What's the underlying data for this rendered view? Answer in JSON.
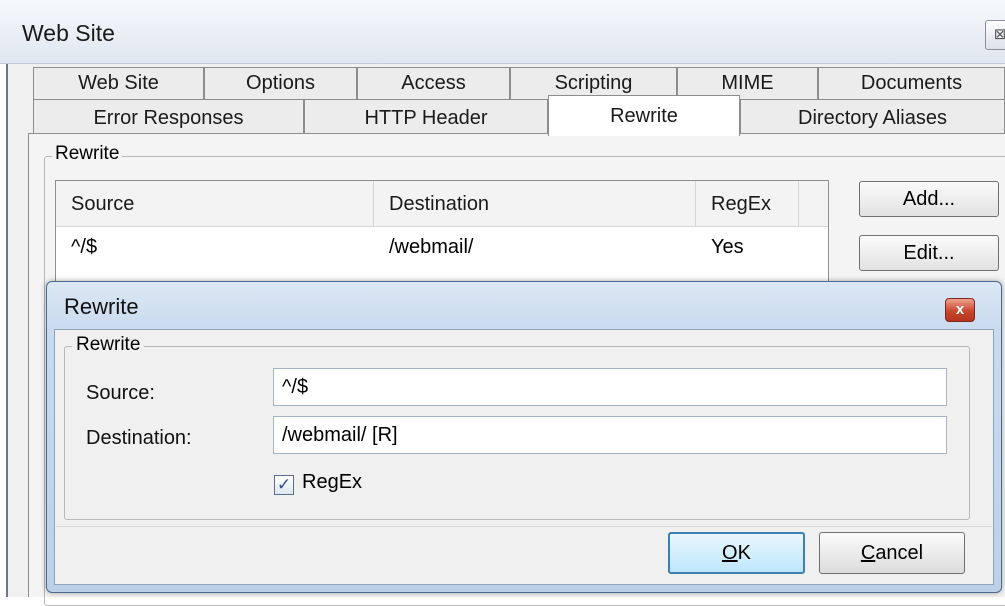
{
  "window": {
    "title": "Web Site",
    "close_glyph": "⊠",
    "icons": {
      "close": "close-icon"
    }
  },
  "tabs": {
    "row1": [
      "Web Site",
      "Options",
      "Access",
      "Scripting",
      "MIME",
      "Documents"
    ],
    "row2": [
      "Error Responses",
      "HTTP Header",
      "Rewrite",
      "Directory Aliases"
    ],
    "active": "Rewrite"
  },
  "rewrite_panel": {
    "group_label": "Rewrite",
    "list": {
      "columns": [
        "Source",
        "Destination",
        "RegEx"
      ],
      "rows": [
        {
          "source": "^/$",
          "destination": "/webmail/",
          "regex": "Yes"
        }
      ]
    },
    "buttons": {
      "add": "Add...",
      "edit": "Edit..."
    }
  },
  "dialog": {
    "title": "Rewrite",
    "close_glyph": "x",
    "group_label": "Rewrite",
    "source_label": "Source:",
    "source_value": "^/$",
    "destination_label": "Destination:",
    "destination_value": "/webmail/ [R]",
    "regex_label": "RegEx",
    "regex_checked": true,
    "check_glyph": "✓",
    "ok_mnemonic": "O",
    "ok_rest": "K",
    "cancel_mnemonic": "C",
    "cancel_rest": "ancel"
  },
  "colors": {
    "dialog_frame": "#c9dbee",
    "close_button": "#c8462e",
    "ok_focus_border": "#3c7fb1"
  }
}
